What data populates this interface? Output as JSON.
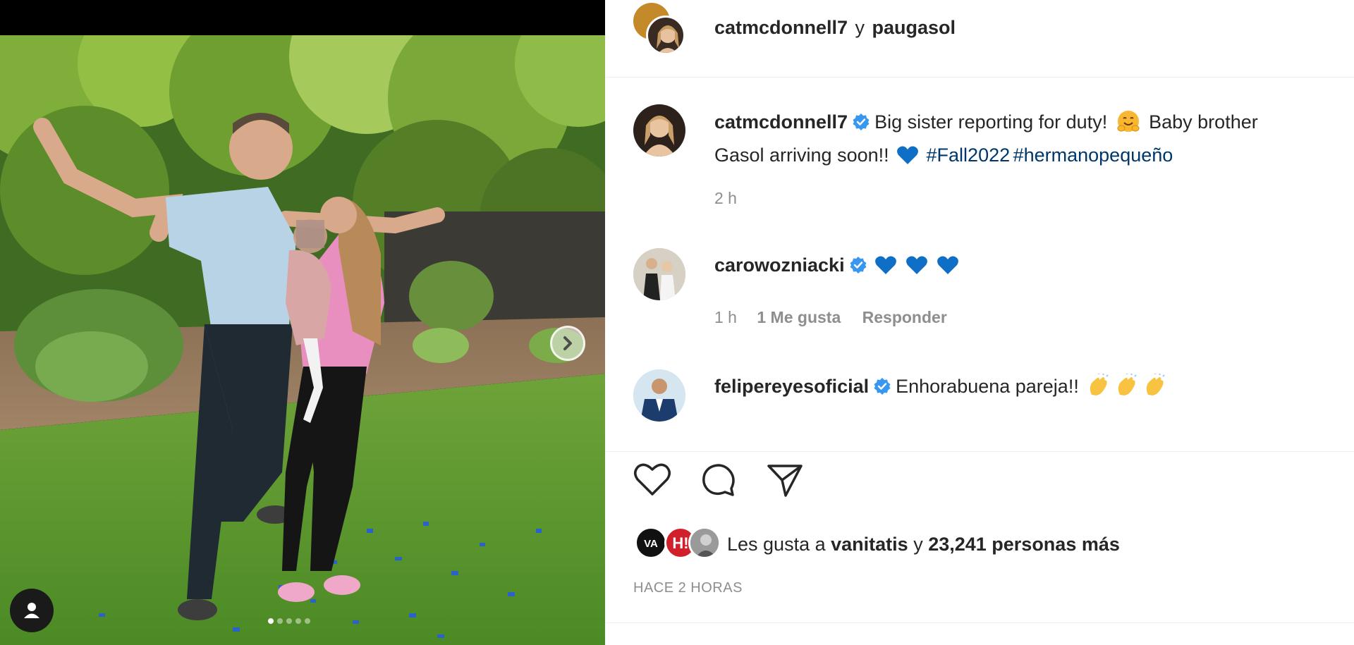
{
  "post": {
    "header": {
      "author": "catmcdonnell7",
      "joiner": "y",
      "coauthor": "paugasol"
    },
    "caption": {
      "username": "catmcdonnell7",
      "text_part1": "Big sister reporting for duty!",
      "text_part2": "Baby brother",
      "text_part3": "Gasol arriving soon!!",
      "hashtag1": "#Fall2022",
      "hashtag2": "#hermanopequeño",
      "time": "2 h"
    },
    "comments": [
      {
        "username": "carowozniacki",
        "hearts": 3,
        "time": "1 h",
        "likes": "1 Me gusta",
        "reply": "Responder"
      },
      {
        "username": "felipereyesoficial",
        "text": "Enhorabuena pareja!!"
      }
    ],
    "likes": {
      "prefix": "Les gusta a",
      "first_user": "vanitatis",
      "joiner": "y",
      "others": "23,241 personas más"
    },
    "timestamp": "HACE 2 HORAS"
  },
  "colors": {
    "verified": "#3897f0",
    "heart": "#0f6fc6",
    "hashtag": "#00376b",
    "meta": "#8e8e8e"
  },
  "icons": [
    "verified-badge-icon",
    "blue-heart-icon",
    "hug-emoji-icon",
    "clap-emoji-icon",
    "like-icon",
    "comment-icon",
    "share-icon",
    "next-arrow-icon",
    "user-tag-icon"
  ]
}
